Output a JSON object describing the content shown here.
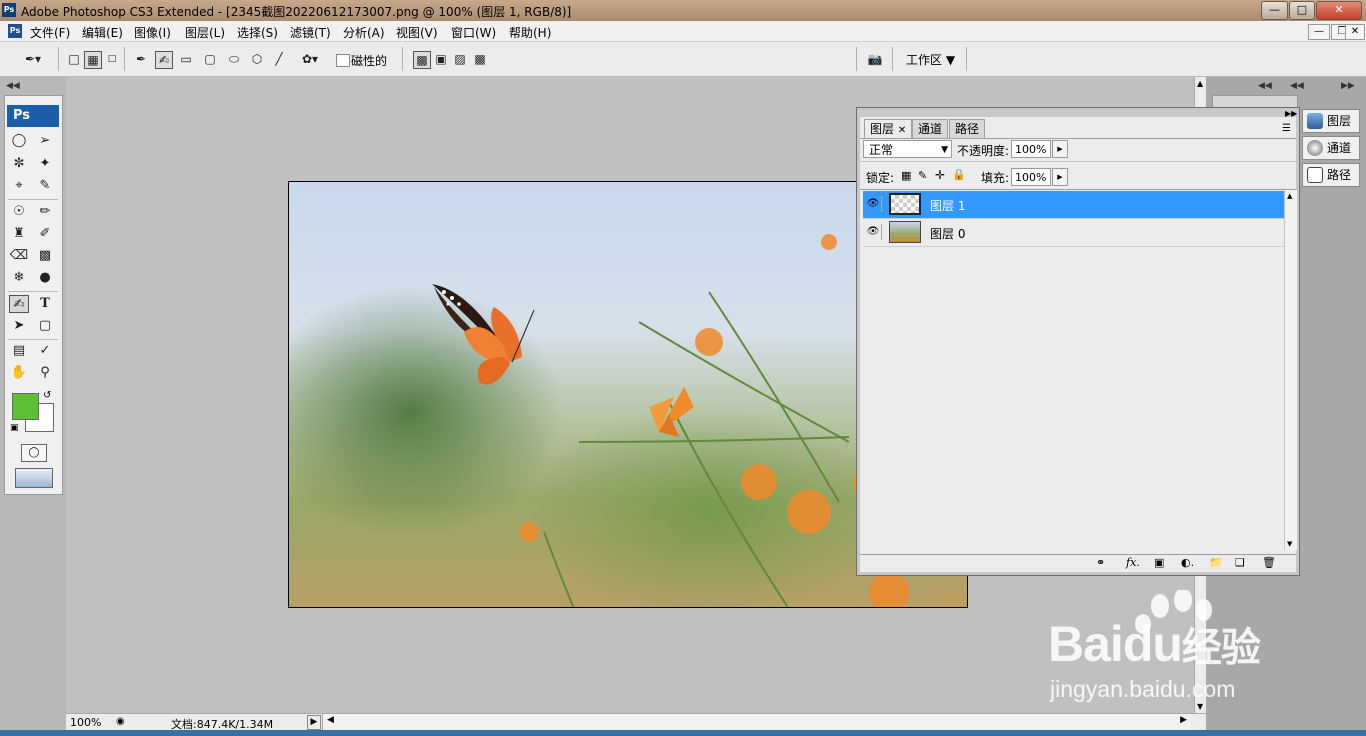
{
  "window": {
    "title": "Adobe Photoshop CS3 Extended - [2345截图20220612173007.png @ 100% (图层 1, RGB/8)]",
    "app_icon": "Ps",
    "controls": [
      "minimize",
      "maximize",
      "close"
    ]
  },
  "menu": {
    "app_icon": "Ps",
    "items": [
      "文件(F)",
      "编辑(E)",
      "图像(I)",
      "图层(L)",
      "选择(S)",
      "滤镜(T)",
      "分析(A)",
      "视图(V)",
      "窗口(W)",
      "帮助(H)"
    ]
  },
  "options_bar": {
    "magnetic_label": "磁性的",
    "magnetic_checked": false,
    "workspace_label": "工作区"
  },
  "toolbox": {
    "logo": "Ps",
    "foreground_color": "#5cbf35",
    "background_color": "#ffffff",
    "type_tool_glyph": "T"
  },
  "layers_panel": {
    "tabs": [
      "图层",
      "通道",
      "路径"
    ],
    "blend_mode": "正常",
    "opacity_label": "不透明度:",
    "opacity_value": "100%",
    "lock_label": "锁定:",
    "fill_label": "填充:",
    "fill_value": "100%",
    "layers": [
      {
        "name": "图层 1",
        "selected": true,
        "visible": true
      },
      {
        "name": "图层 0",
        "selected": false,
        "visible": true
      }
    ],
    "selected_color": "#3399ff"
  },
  "dock": {
    "items": [
      "图层",
      "通道",
      "路径"
    ]
  },
  "status": {
    "zoom": "100%",
    "doc_info": "文档:847.4K/1.34M"
  },
  "watermark": {
    "brand": "Bai",
    "brand2": "du",
    "suffix": "经验",
    "url": "jingyan.baidu.com"
  }
}
